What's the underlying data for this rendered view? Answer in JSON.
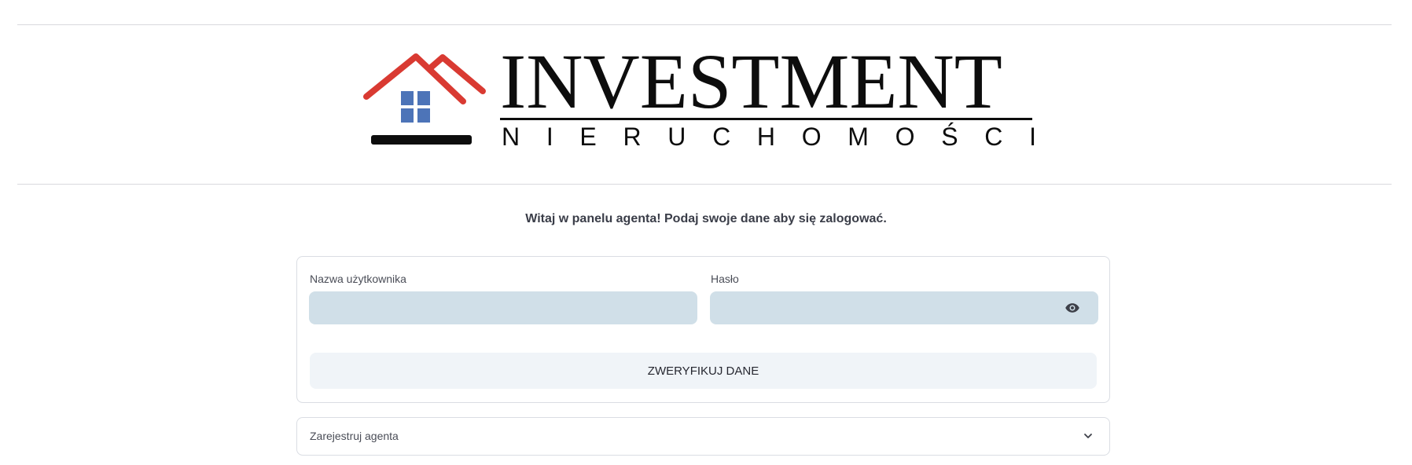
{
  "brand": {
    "name": "INVESTMENT",
    "tagline_letters": [
      "N",
      "I",
      "E",
      "R",
      "U",
      "C",
      "H",
      "O",
      "M",
      "O",
      "Ś",
      "C",
      "I"
    ],
    "colors": {
      "roof": "#d93a32",
      "window": "#4d74b8",
      "ink": "#0d0d0d"
    }
  },
  "welcome": "Witaj w panelu agenta! Podaj swoje dane aby się zalogować.",
  "form": {
    "username_label": "Nazwa użytkownika",
    "username_value": "",
    "password_label": "Hasło",
    "password_value": "",
    "password_toggle_icon": "eye-icon",
    "submit_label": "ZWERYFIKUJ DANE",
    "input_bg": "#d0dfe8"
  },
  "register": {
    "label": "Zarejestruj agenta",
    "icon": "chevron-down-icon"
  }
}
